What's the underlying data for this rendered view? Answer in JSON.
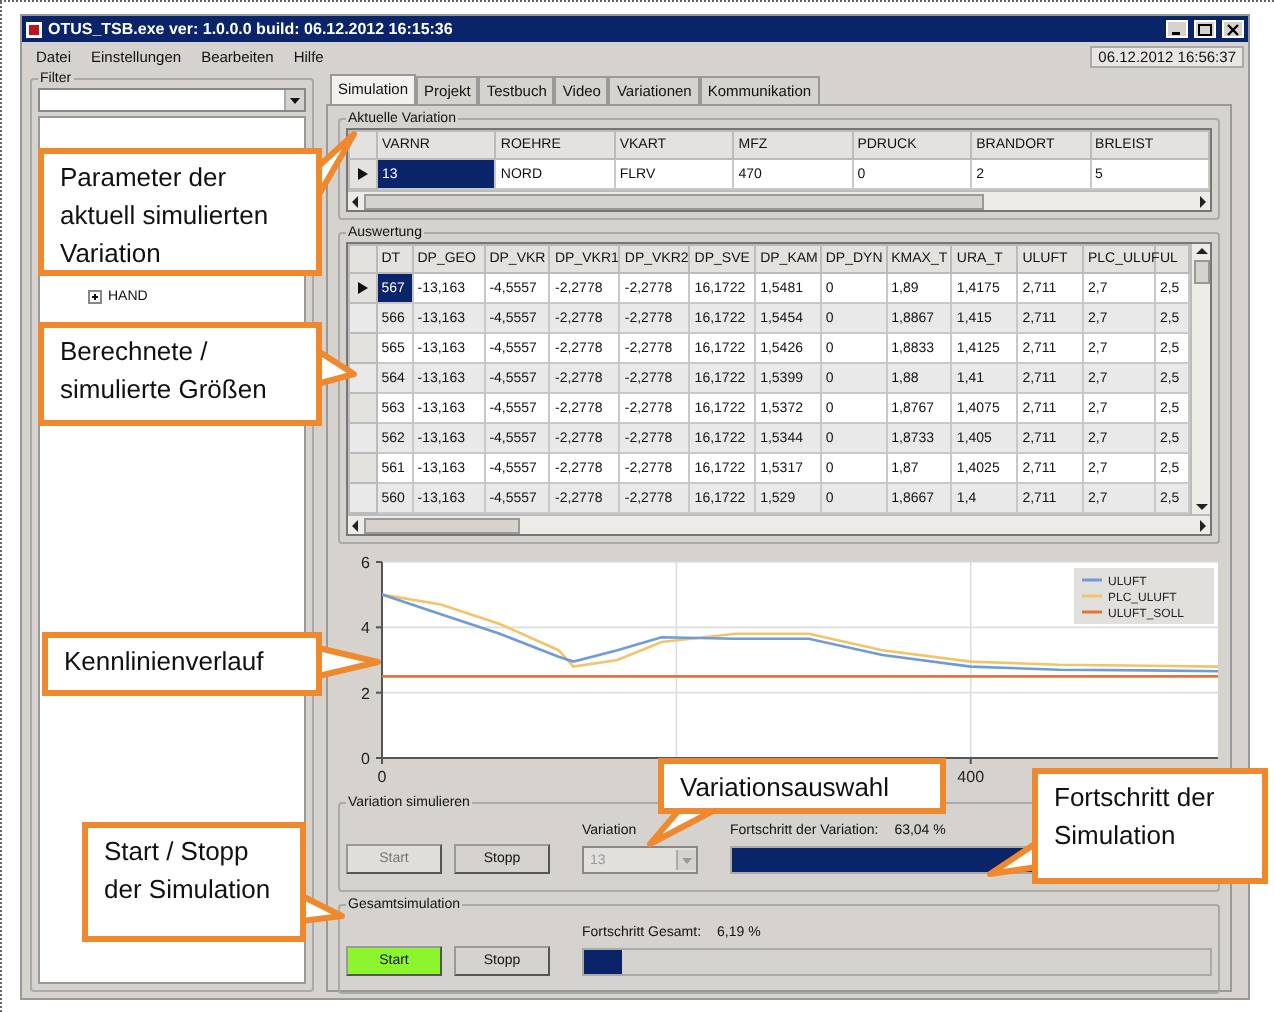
{
  "window": {
    "title": "OTUS_TSB.exe ver: 1.0.0.0 build: 06.12.2012 16:15:36"
  },
  "menu": [
    "Datei",
    "Einstellungen",
    "Bearbeiten",
    "Hilfe"
  ],
  "clock": "06.12.2012 16:56:37",
  "filter": {
    "title": "Filter",
    "tree": [
      {
        "label": "HAND",
        "expanded": false
      }
    ]
  },
  "tabs": [
    {
      "label": "Simulation",
      "selected": true
    },
    {
      "label": "Projekt",
      "selected": false
    },
    {
      "label": "Testbuch",
      "selected": false
    },
    {
      "label": "Video",
      "selected": false
    },
    {
      "label": "Variationen",
      "selected": false
    },
    {
      "label": "Kommunikation",
      "selected": false
    }
  ],
  "current_variation": {
    "title": "Aktuelle Variation",
    "columns": [
      "VARNR",
      "ROEHRE",
      "VKART",
      "MFZ",
      "PDRUCK",
      "BRANDORT",
      "BRLEIST"
    ],
    "rows": [
      {
        "selected": true,
        "cells": [
          "13",
          "NORD",
          "FLRV",
          "470",
          "0",
          "2",
          "5"
        ]
      }
    ]
  },
  "evaluation": {
    "title": "Auswertung",
    "columns": [
      "DT",
      "DP_GEO",
      "DP_VKR",
      "DP_VKR1",
      "DP_VKR2",
      "DP_SVE",
      "DP_KAM",
      "DP_DYN",
      "KMAX_T",
      "URA_T",
      "ULUFT",
      "PLC_ULUF",
      "UL"
    ],
    "rows": [
      {
        "selected": true,
        "cells": [
          "567",
          "-13,163",
          "-4,5557",
          "-2,2778",
          "-2,2778",
          "16,1722",
          "1,5481",
          "0",
          "1,89",
          "1,4175",
          "2,711",
          "2,7",
          "2,5"
        ]
      },
      {
        "selected": false,
        "cells": [
          "566",
          "-13,163",
          "-4,5557",
          "-2,2778",
          "-2,2778",
          "16,1722",
          "1,5454",
          "0",
          "1,8867",
          "1,415",
          "2,711",
          "2,7",
          "2,5"
        ]
      },
      {
        "selected": false,
        "cells": [
          "565",
          "-13,163",
          "-4,5557",
          "-2,2778",
          "-2,2778",
          "16,1722",
          "1,5426",
          "0",
          "1,8833",
          "1,4125",
          "2,711",
          "2,7",
          "2,5"
        ]
      },
      {
        "selected": false,
        "cells": [
          "564",
          "-13,163",
          "-4,5557",
          "-2,2778",
          "-2,2778",
          "16,1722",
          "1,5399",
          "0",
          "1,88",
          "1,41",
          "2,711",
          "2,7",
          "2,5"
        ]
      },
      {
        "selected": false,
        "cells": [
          "563",
          "-13,163",
          "-4,5557",
          "-2,2778",
          "-2,2778",
          "16,1722",
          "1,5372",
          "0",
          "1,8767",
          "1,4075",
          "2,711",
          "2,7",
          "2,5"
        ]
      },
      {
        "selected": false,
        "cells": [
          "562",
          "-13,163",
          "-4,5557",
          "-2,2778",
          "-2,2778",
          "16,1722",
          "1,5344",
          "0",
          "1,8733",
          "1,405",
          "2,711",
          "2,7",
          "2,5"
        ]
      },
      {
        "selected": false,
        "cells": [
          "561",
          "-13,163",
          "-4,5557",
          "-2,2778",
          "-2,2778",
          "16,1722",
          "1,5317",
          "0",
          "1,87",
          "1,4025",
          "2,711",
          "2,7",
          "2,5"
        ]
      },
      {
        "selected": false,
        "cells": [
          "560",
          "-13,163",
          "-4,5557",
          "-2,2778",
          "-2,2778",
          "16,1722",
          "1,529",
          "0",
          "1,8667",
          "1,4",
          "2,711",
          "2,7",
          "2,5"
        ]
      }
    ]
  },
  "chart": {
    "chart_data": {
      "type": "line",
      "x": [
        0,
        40,
        80,
        120,
        130,
        160,
        190,
        240,
        290,
        340,
        400,
        460,
        520,
        568
      ],
      "series": [
        {
          "name": "ULUFT",
          "color": "#6f9bd8",
          "values": [
            5.0,
            4.4,
            3.8,
            3.1,
            2.95,
            3.3,
            3.7,
            3.65,
            3.65,
            3.15,
            2.8,
            2.7,
            2.68,
            2.66
          ]
        },
        {
          "name": "PLC_ULUFT",
          "color": "#f2c46a",
          "values": [
            5.0,
            4.7,
            4.1,
            3.3,
            2.8,
            3.0,
            3.55,
            3.8,
            3.8,
            3.3,
            2.95,
            2.85,
            2.82,
            2.8
          ]
        },
        {
          "name": "ULUFT_SOLL",
          "color": "#e8703a",
          "values": [
            2.5,
            2.5,
            2.5,
            2.5,
            2.5,
            2.5,
            2.5,
            2.5,
            2.5,
            2.5,
            2.5,
            2.5,
            2.5,
            2.5
          ]
        }
      ],
      "xlim": [
        0,
        568
      ],
      "ylim": [
        0,
        6
      ],
      "xticks": [
        {
          "value": 0,
          "label": "0"
        },
        {
          "value": 400,
          "label": "400"
        }
      ],
      "yticks": [
        {
          "value": 0,
          "label": "0"
        },
        {
          "value": 2,
          "label": "2"
        },
        {
          "value": 4,
          "label": "4"
        },
        {
          "value": 6,
          "label": "6"
        }
      ],
      "grid": true,
      "legend": true
    }
  },
  "variation_sim": {
    "title": "Variation simulieren",
    "start": {
      "label": "Start",
      "disabled": true
    },
    "stop": {
      "label": "Stopp",
      "disabled": false
    },
    "variation": {
      "label": "Variation",
      "value": "13",
      "disabled": true
    },
    "progress": {
      "label": "Fortschritt der Variation:",
      "reading": "63,04 %",
      "level": 0.6304
    }
  },
  "total_sim": {
    "title": "Gesamtsimulation",
    "start": {
      "label": "Start",
      "active": true
    },
    "stop": {
      "label": "Stopp",
      "active": false
    },
    "progress": {
      "label": "Fortschritt Gesamt:",
      "reading": "6,19 %",
      "level": 0.0619
    }
  },
  "callouts": [
    "Parameter der aktuell simulierten Variation",
    "Berechnete / simulierte Größen",
    "Kennlinienverlauf",
    "Variationsauswahl",
    "Fortschritt der Simulation",
    "Start / Stopp der Simulation"
  ]
}
